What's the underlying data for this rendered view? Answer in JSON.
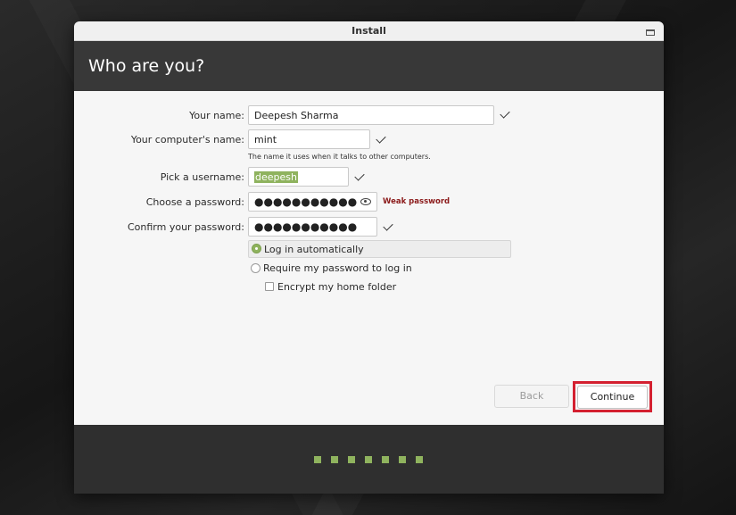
{
  "window": {
    "title": "Install",
    "page_title": "Who are you?"
  },
  "form": {
    "name": {
      "label": "Your name:",
      "value": "Deepesh Sharma"
    },
    "computer_name": {
      "label": "Your computer's name:",
      "value": "mint",
      "hint": "The name it uses when it talks to other computers."
    },
    "username": {
      "label": "Pick a username:",
      "value": "deepesh"
    },
    "password": {
      "label": "Choose a password:",
      "value": "●●●●●●●●●●●",
      "strength": "Weak password"
    },
    "confirm_password": {
      "label": "Confirm your password:",
      "value": "●●●●●●●●●●●"
    }
  },
  "options": {
    "auto_login": {
      "label": "Log in automatically",
      "selected": true
    },
    "require_password": {
      "label": "Require my password to log in",
      "selected": false
    },
    "encrypt_home": {
      "label": "Encrypt my home folder",
      "checked": false
    }
  },
  "buttons": {
    "back": "Back",
    "continue": "Continue"
  },
  "progress": {
    "steps": 7
  },
  "colors": {
    "accent": "#8fb35e",
    "highlight": "#d42030",
    "warning": "#8b1a1a"
  }
}
